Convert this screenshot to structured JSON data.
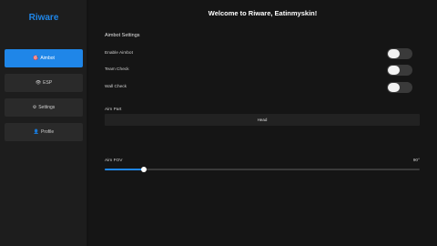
{
  "sidebar": {
    "brand": "Riware",
    "items": [
      {
        "label": "Aimbot",
        "icon": "crosshair-icon",
        "glyph": "🎯",
        "active": true
      },
      {
        "label": "ESP",
        "icon": "eye-icon",
        "glyph": "👁",
        "active": false
      },
      {
        "label": "Settings",
        "icon": "gear-icon",
        "glyph": "⚙",
        "active": false
      },
      {
        "label": "Profile",
        "icon": "user-icon",
        "glyph": "👤",
        "active": false
      }
    ]
  },
  "main": {
    "title": "Welcome to Riware, Eatinmyskin!",
    "section_title": "Aimbot Settings",
    "toggles": [
      {
        "label": "Enable Aimbot",
        "on": false
      },
      {
        "label": "Team Check",
        "on": false
      },
      {
        "label": "Wall Check",
        "on": false
      }
    ],
    "aim_part": {
      "label": "Aim Part",
      "value": "Head"
    },
    "fov": {
      "label": "Aim FOV",
      "value_text": "90°",
      "fraction": 0.125
    }
  },
  "colors": {
    "accent": "#1f86e8",
    "sidebar_bg": "#1d1d1d",
    "main_bg": "#151515"
  }
}
